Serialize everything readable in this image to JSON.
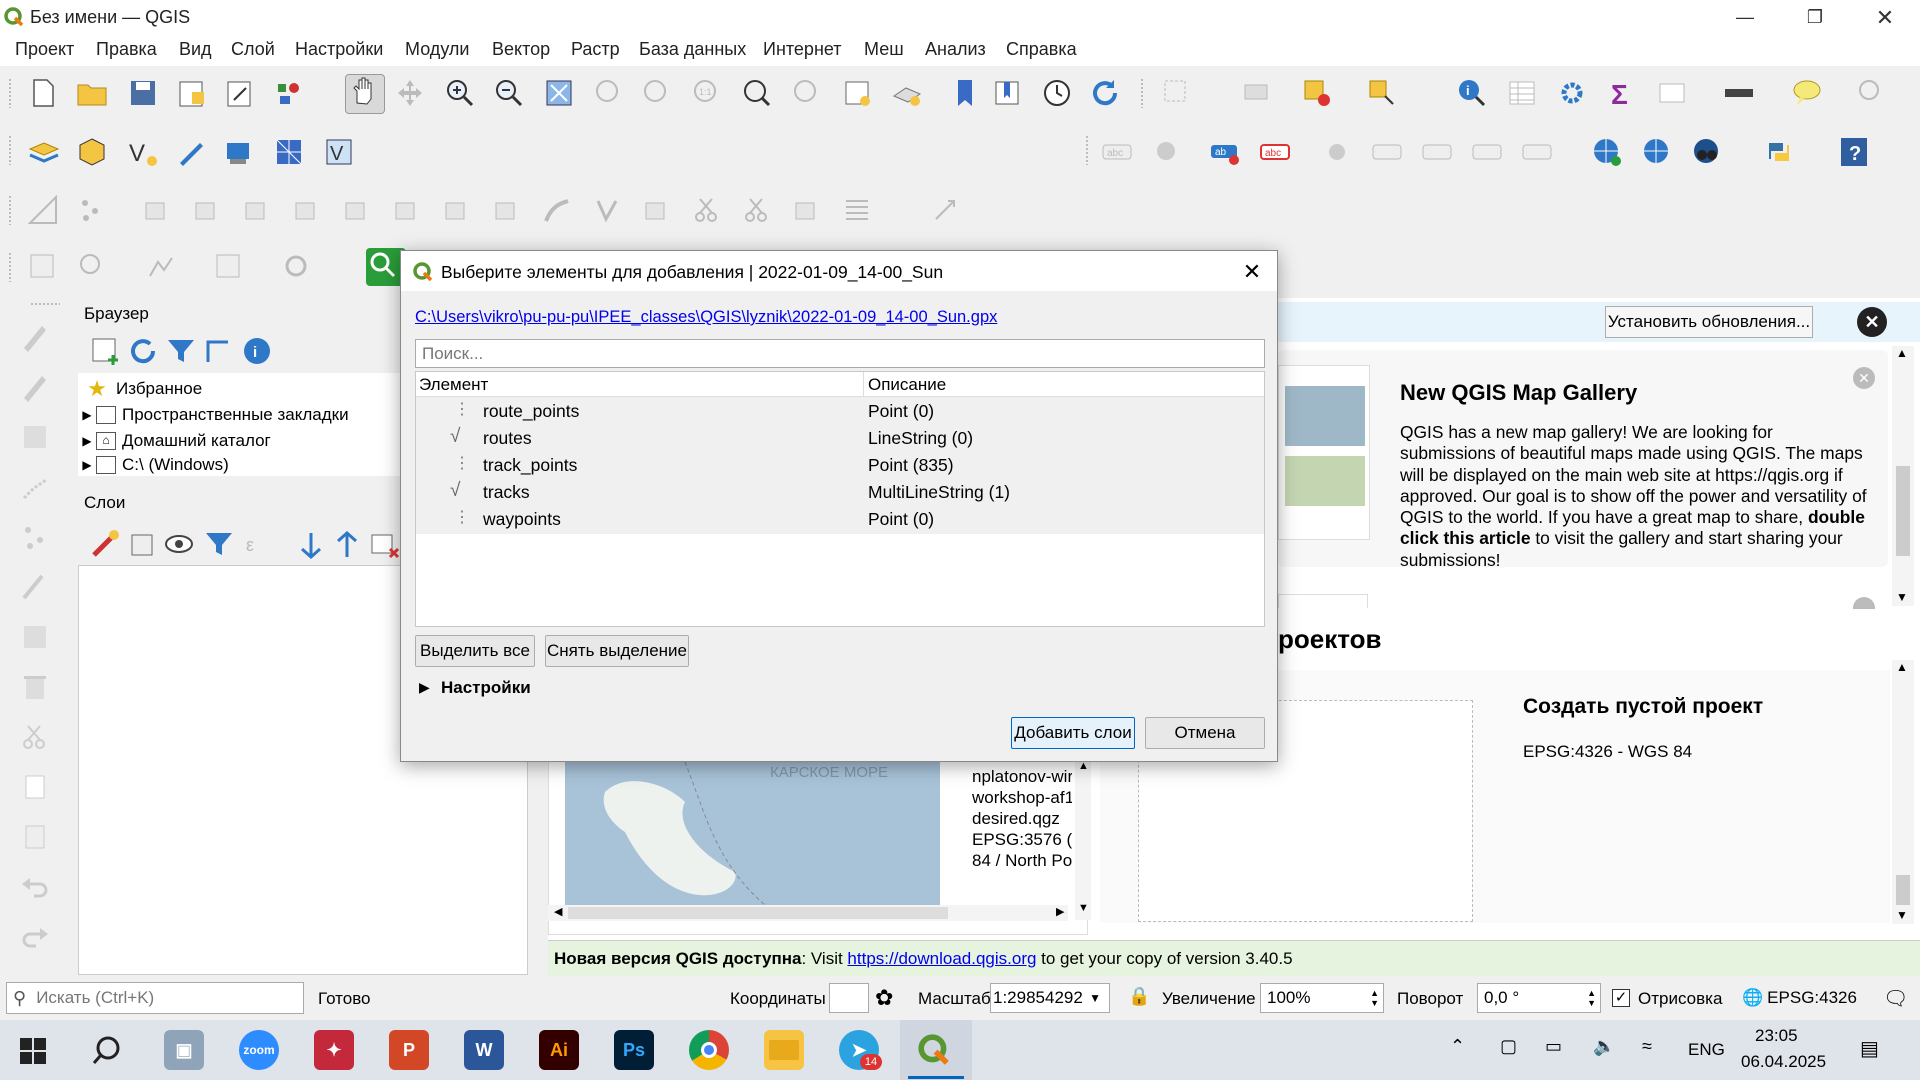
{
  "window": {
    "title": "Без имени — QGIS"
  },
  "menu": [
    "Проект",
    "Правка",
    "Вид",
    "Слой",
    "Настройки",
    "Модули",
    "Вектор",
    "Растр",
    "База данных",
    "Интернет",
    "Меш",
    "Анализ",
    "Справка"
  ],
  "browser": {
    "title": "Браузер",
    "items": [
      "Избранное",
      "Пространственные закладки",
      "Домашний каталог",
      "C:\\ (Windows)"
    ]
  },
  "layers": {
    "title": "Слои"
  },
  "update": {
    "button": "Установить обновления..."
  },
  "news": {
    "title": "New QGIS Map Gallery",
    "body_1": "QGIS has a new map gallery! We are looking for submissions of beautiful maps made using QGIS. The maps will be displayed on the main web site at https://qgis.org if approved. Our goal is to show off the power and versatility of QGIS to the world. If you have a great map to share, ",
    "body_bold": "double click this article",
    "body_2": " to visit the gallery and start sharing your submissions!"
  },
  "projects": {
    "heading_partial": "роектов",
    "new_title": "Создать пустой проект",
    "new_crs": "EPSG:4326 - WGS 84",
    "recent_lines": [
      "nplatonov-wir",
      "workshop-af1",
      "desired.qgz",
      "EPSG:3576 (E",
      "84 / North Po"
    ],
    "map_label": "КАРСКОЕ МОРЕ"
  },
  "greenbar": {
    "bold": "Новая версия QGIS доступна",
    "pre": ": Visit ",
    "link": "https://download.qgis.org",
    "post": " to get your copy of version 3.40.5"
  },
  "dialog": {
    "title": "Выберите элементы для добавления | 2022-01-09_14-00_Sun",
    "path": "C:\\Users\\vikro\\pu-pu-pu\\IPEE_classes\\QGIS\\lyznik\\2022-01-09_14-00_Sun.gpx",
    "search_placeholder": "Поиск...",
    "col_element": "Элемент",
    "col_desc": "Описание",
    "rows": [
      {
        "name": "route_points",
        "desc": "Point (0)",
        "icon": "point-layer-icon"
      },
      {
        "name": "routes",
        "desc": "LineString (0)",
        "icon": "line-layer-icon"
      },
      {
        "name": "track_points",
        "desc": "Point (835)",
        "icon": "point-layer-icon"
      },
      {
        "name": "tracks",
        "desc": "MultiLineString (1)",
        "icon": "line-layer-icon"
      },
      {
        "name": "waypoints",
        "desc": "Point (0)",
        "icon": "point-layer-icon"
      }
    ],
    "select_all": "Выделить все",
    "deselect": "Снять выделение",
    "settings": "Настройки",
    "add": "Добавить слои",
    "cancel": "Отмена"
  },
  "status": {
    "search_placeholder": "Искать (Ctrl+K)",
    "ready": "Готово",
    "coords_label": "Координаты",
    "scale_label": "Масштаб",
    "scale_value": "1:29854292",
    "zoom_label": "Увеличение",
    "zoom_value": "100%",
    "rotation_label": "Поворот",
    "rotation_value": "0,0 °",
    "render_label": "Отрисовка",
    "crs": "EPSG:4326"
  },
  "taskbar": {
    "lang": "ENG",
    "time": "23:05",
    "date": "06.04.2025",
    "telegram_badge": "14",
    "apps": [
      "start",
      "search",
      "file-viewer",
      "zoom",
      "acrobat",
      "powerpoint",
      "word",
      "illustrator",
      "photoshop",
      "chrome",
      "explorer",
      "telegram",
      "qgis"
    ]
  },
  "colors": {
    "accent": "#1f8a3b",
    "link": "#0000ee",
    "update_bar": "#e8f4fc",
    "green_bar": "#e6f3df"
  }
}
